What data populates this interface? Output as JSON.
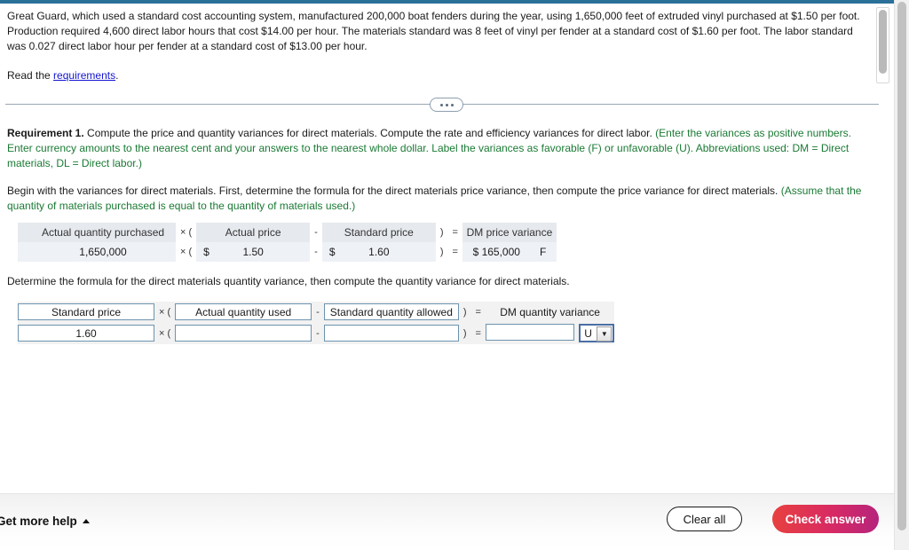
{
  "problem": {
    "statement": "Great Guard, which used a standard cost accounting system, manufactured 200,000 boat fenders during the year, using 1,650,000 feet of extruded vinyl purchased at $1.50 per foot. Production required 4,600 direct labor hours that cost $14.00 per hour. The materials standard was 8 feet of vinyl per fender at a standard cost of $1.60 per foot. The labor standard was 0.027 direct labor hour per fender at a standard cost of $13.00 per hour.",
    "read_prefix": "Read the ",
    "read_link": "requirements",
    "read_suffix": "."
  },
  "divider": {
    "expand_label": "•••"
  },
  "requirement": {
    "heading": "Requirement 1.",
    "body": " Compute the price and quantity variances for direct materials. Compute the rate and efficiency variances for direct labor. ",
    "instruction": "(Enter the variances as positive numbers. Enter currency amounts to the nearest cent and your answers to the nearest whole dollar. Label the variances as favorable (F) or unfavorable (U). Abbreviations used: DM = Direct materials, DL = Direct labor.)",
    "begin_text": "Begin with the variances for direct materials. First, determine the formula for the direct materials price variance, then compute the price variance for direct materials. ",
    "begin_note": "(Assume that the quantity of materials purchased is equal to the quantity of materials used.)",
    "determine_text": "Determine the formula for the direct materials quantity variance, then compute the quantity variance for direct materials."
  },
  "price_table": {
    "headers": {
      "actual_quantity": "Actual quantity purchased",
      "actual_price": "Actual price",
      "standard_price": "Standard price",
      "result": "DM price variance"
    },
    "operators": {
      "open": "× (",
      "minus": "-",
      "close": ")",
      "equals": "="
    },
    "values": {
      "actual_quantity": "1,650,000",
      "actual_price_symbol": "$",
      "actual_price": "1.50",
      "standard_price_symbol": "$",
      "standard_price": "1.60",
      "result_amount": "$ 165,000",
      "result_flag": "F"
    }
  },
  "quantity_table": {
    "headers": {
      "standard_price": "Standard price",
      "actual_quantity_used": "Actual quantity used",
      "standard_quantity_allowed": "Standard quantity allowed",
      "result": "DM quantity variance"
    },
    "operators": {
      "open": "× (",
      "minus": "-",
      "close": ")",
      "equals": "="
    },
    "values": {
      "standard_price": "1.60",
      "actual_quantity_used": "",
      "standard_quantity_allowed": "",
      "result_amount": "",
      "result_flag": "U"
    },
    "flag_arrow": "▼"
  },
  "footer": {
    "get_more_help": "Get more help",
    "clear_all": "Clear all",
    "check_answer": "Check answer"
  },
  "colors": {
    "top_bar": "#2a7099",
    "link": "#1414d2",
    "green_note": "#1a7a34",
    "check_answer_start": "#e8413f",
    "check_answer_end": "#b4247d",
    "field_border": "#6d93ad",
    "select_focus_border": "#4a6fa5"
  }
}
